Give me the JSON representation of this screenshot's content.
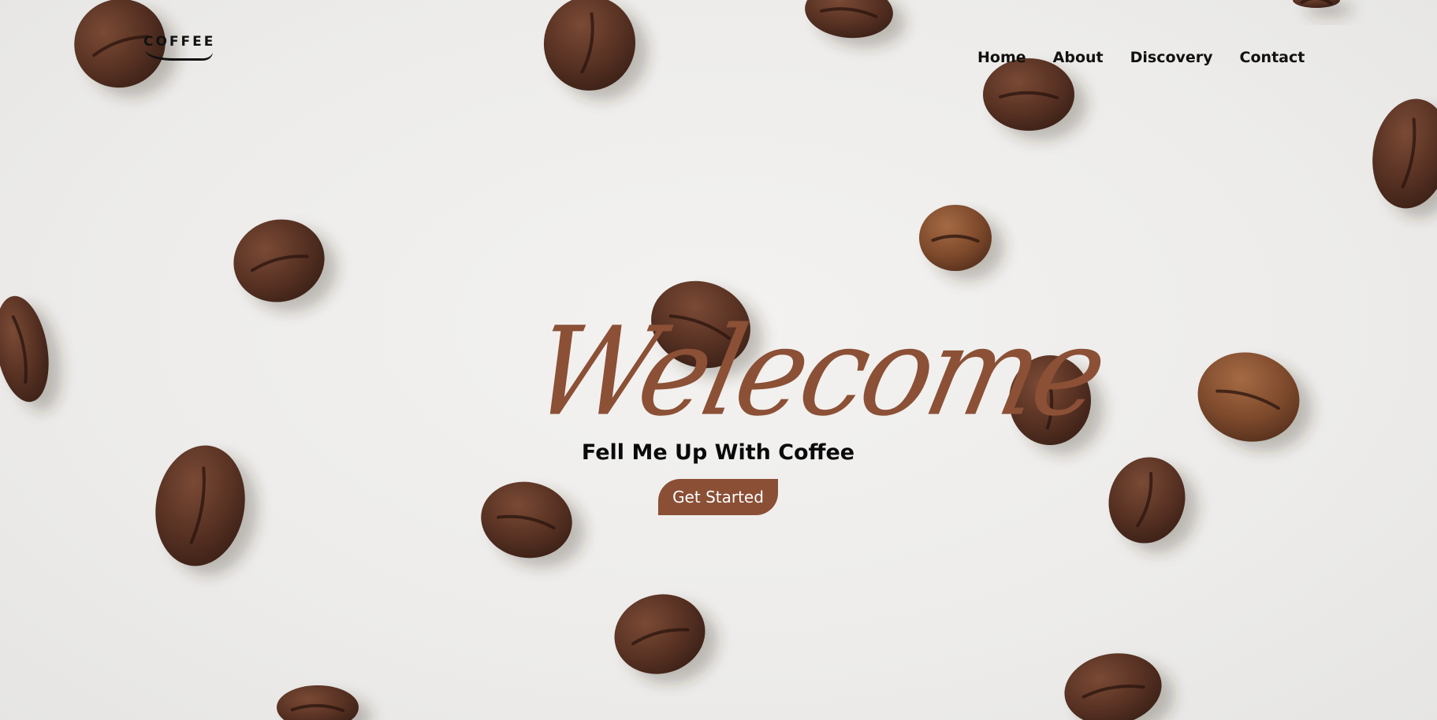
{
  "header": {
    "logo_text": "COFFEE",
    "nav": [
      {
        "label": "Home"
      },
      {
        "label": "About"
      },
      {
        "label": "Discovery"
      },
      {
        "label": "Contact"
      }
    ]
  },
  "hero": {
    "welcome": "Welecome",
    "tagline": "Fell Me Up With Coffee",
    "cta_label": "Get Started"
  },
  "colors": {
    "accent": "#8a4f35",
    "welcome_text": "#8b5036",
    "background": "#efeeec",
    "text": "#111111"
  },
  "icons": {
    "logo_swoosh": "logo-swoosh-icon",
    "decor": "coffee-bean-icon"
  }
}
